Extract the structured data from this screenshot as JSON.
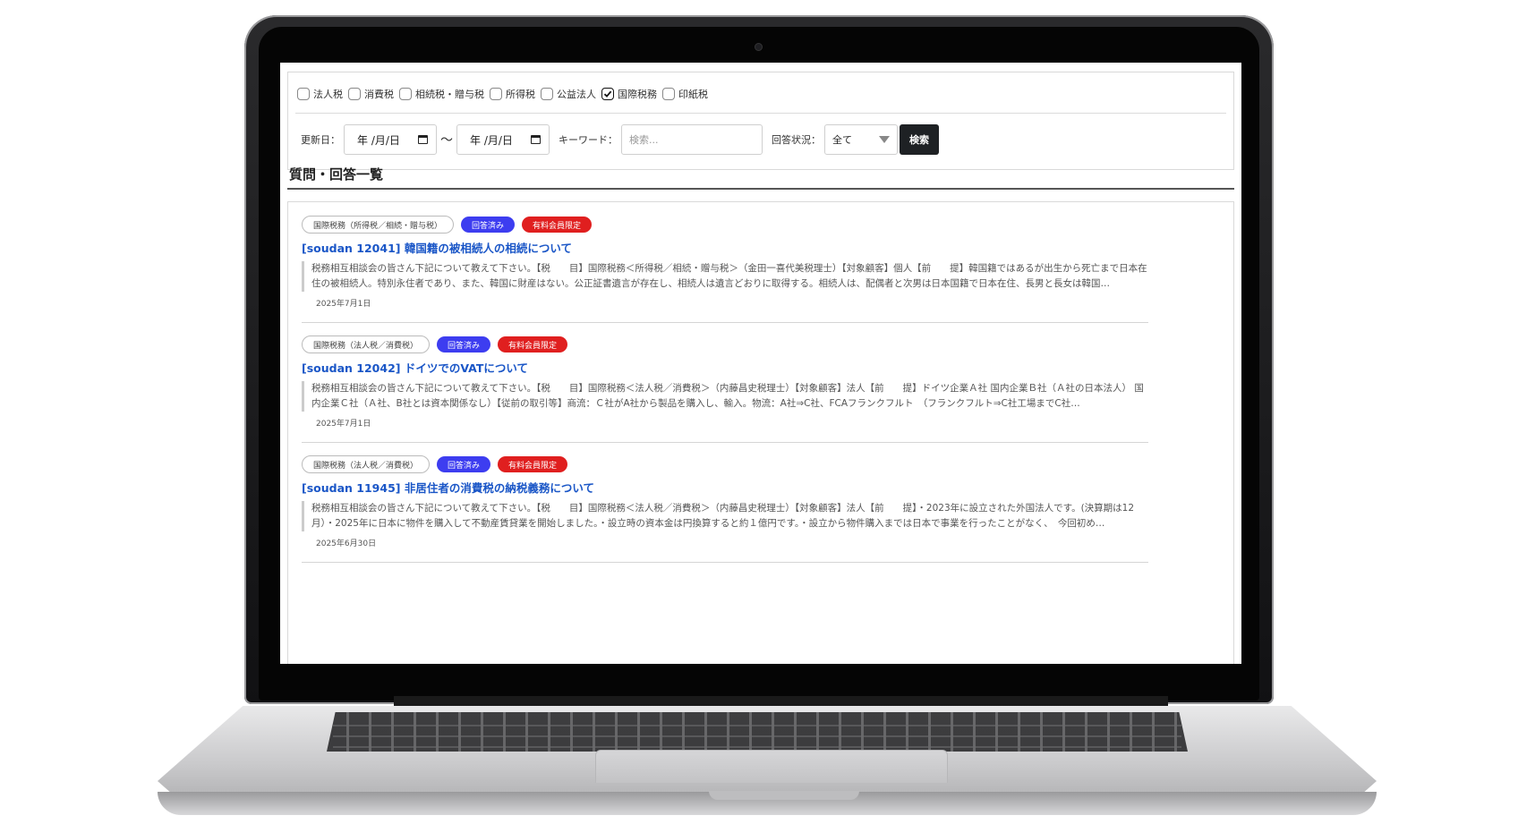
{
  "categories": [
    {
      "label": "法人税",
      "checked": false
    },
    {
      "label": "消費税",
      "checked": false
    },
    {
      "label": "相続税・贈与税",
      "checked": false
    },
    {
      "label": "所得税",
      "checked": false
    },
    {
      "label": "公益法人",
      "checked": false
    },
    {
      "label": "国際税務",
      "checked": true
    },
    {
      "label": "印紙税",
      "checked": false
    }
  ],
  "search": {
    "updated_label": "更新日：",
    "date_from": "年 /月/日",
    "date_sep": "〜",
    "date_to": "年 /月/日",
    "keyword_label": "キーワード：",
    "keyword_placeholder": "検索...",
    "status_label": "回答状況：",
    "status_value": "全て",
    "search_button": "検索"
  },
  "section_title": "質問・回答一覧",
  "items": [
    {
      "category": "国際税務（所得税／相続・贈与税）",
      "status": "回答済み",
      "member": "有料会員限定",
      "title": "[soudan 12041] 韓国籍の被相続人の相続について",
      "excerpt": "税務相互相談会の皆さん下記について教えて下さい。【税　　目】国際税務＜所得税／相続・贈与税＞（金田一喜代美税理士）【対象顧客】個人【前　　提】韓国籍ではあるが出生から死亡まで日本在住の被相続人。特別永住者であり、また、韓国に財産はない。公正証書遺言が存在し、相続人は遺言どおりに取得する。相続人は、配偶者と次男は日本国籍で日本在住、長男と長女は韓国…",
      "date": "2025年7月1日"
    },
    {
      "category": "国際税務（法人税／消費税）",
      "status": "回答済み",
      "member": "有料会員限定",
      "title": "[soudan 12042] ドイツでのVATについて",
      "excerpt": "税務相互相談会の皆さん下記について教えて下さい。【税　　目】国際税務＜法人税／消費税＞（内藤昌史税理士）【対象顧客】法人【前　　提】ドイツ企業Ａ社 国内企業Ｂ社（Ａ社の日本法人） 国内企業Ｃ社（Ａ社、B社とは資本関係なし）【従前の取引等】商流：Ｃ社がA社から製品を購入し、輸入。物流：A社⇒C社、FCAフランクフルト　（フランクフルト⇒C社工場までC社…",
      "date": "2025年7月1日"
    },
    {
      "category": "国際税務（法人税／消費税）",
      "status": "回答済み",
      "member": "有料会員限定",
      "title": "[soudan 11945] 非居住者の消費税の納税義務について",
      "excerpt": "税務相互相談会の皆さん下記について教えて下さい。【税　　目】国際税務＜法人税／消費税＞（内藤昌史税理士）【対象顧客】法人【前　　提】・2023年に設立された外国法人です。(決算期は12月）・2025年に日本に物件を購入して不動産賃貸業を開始しました。・設立時の資本金は円換算すると約１億円です。・設立から物件購入までは日本で事業を行ったことがなく、　今回初め…",
      "date": "2025年6月30日"
    }
  ]
}
